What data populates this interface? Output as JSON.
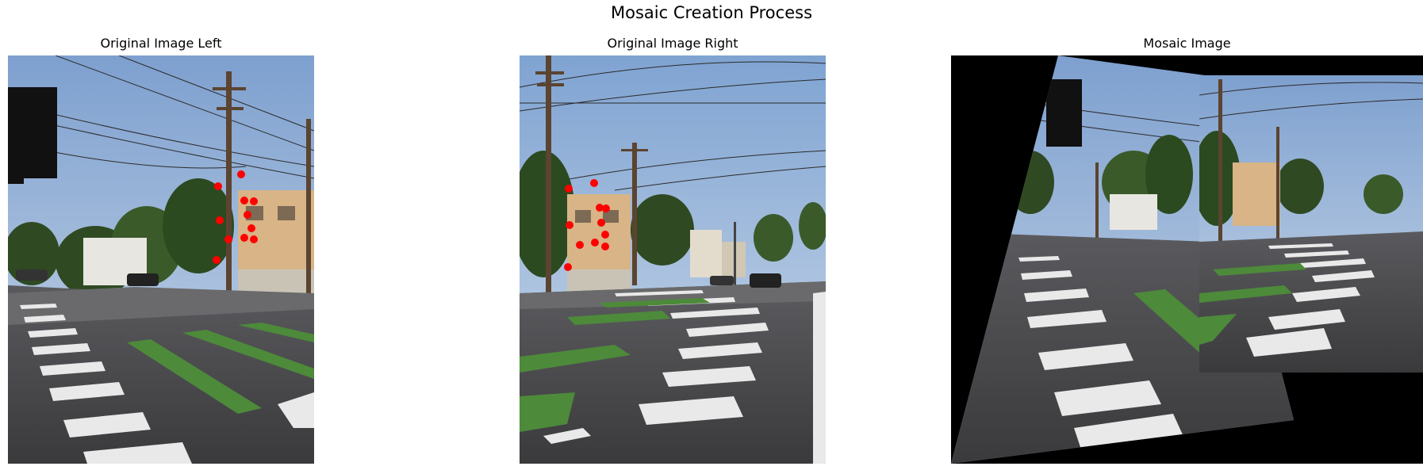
{
  "figure": {
    "title": "Mosaic Creation Process"
  },
  "panels": {
    "left": {
      "title": "Original Image Left"
    },
    "right": {
      "title": "Original Image Right"
    },
    "mosaic": {
      "title": "Mosaic Image"
    }
  },
  "colors": {
    "correspondence_points": "#ff0000",
    "background": "#ffffff",
    "mosaic_empty": "#000000"
  }
}
